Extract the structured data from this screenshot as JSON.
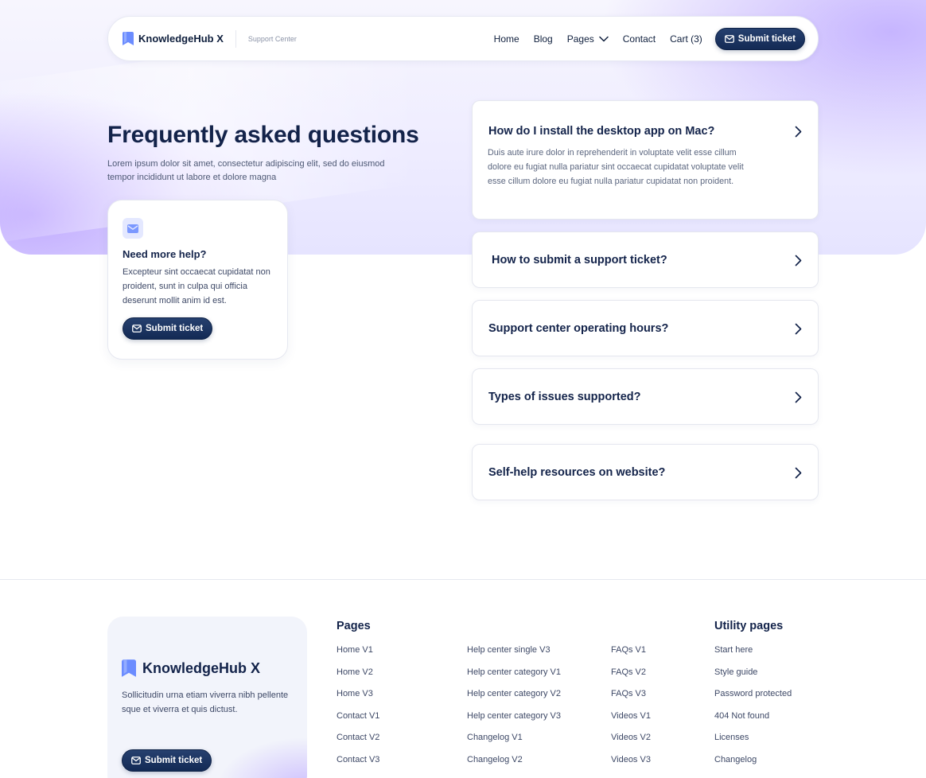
{
  "brand": {
    "name": "KnowledgeHub X",
    "subtitle": "Support Center"
  },
  "nav": {
    "links": [
      "Home",
      "Blog",
      "Pages",
      "Contact",
      "Cart (3)"
    ],
    "cta": "Submit ticket"
  },
  "hero": {
    "title": "Frequently asked questions",
    "description": "Lorem ipsum dolor sit amet, consectetur adipiscing elit, sed do eiusmod tempor incididunt ut labore et dolore magna"
  },
  "help_card": {
    "title": "Need more help?",
    "text": "Excepteur sint occaecat cupidatat non proident, sunt in culpa qui officia deserunt mollit anim id est.",
    "button": "Submit ticket"
  },
  "faqs": [
    {
      "question": "How do I install the desktop app on Mac?",
      "answer": "Duis aute irure dolor in reprehenderit in voluptate velit esse cillum dolore eu fugiat nulla pariatur sint occaecat cupidatat voluptate velit esse cillum dolore eu fugiat nulla pariatur cupidatat non proident.",
      "expanded": true
    },
    {
      "question": "How to submit a support ticket?",
      "expanded": false
    },
    {
      "question": "Support center operating hours?",
      "expanded": false
    },
    {
      "question": "Types of issues supported?",
      "expanded": false
    },
    {
      "question": "Self-help resources on website?",
      "expanded": false
    }
  ],
  "footer": {
    "brand_name": "KnowledgeHub X",
    "text": "Sollicitudin urna etiam viverra nibh pellente sque et viverra et quis dictust.",
    "button": "Submit ticket",
    "pages_title": "Pages",
    "pages_col1": [
      "Home V1",
      "Home V2",
      "Home V3",
      "Contact V1",
      "Contact V2",
      "Contact V3"
    ],
    "pages_col2": [
      "Help center single V3",
      "Help center category V1",
      "Help center category V2",
      "Help center category V3",
      "Changelog V1",
      "Changelog V2"
    ],
    "pages_col3": [
      "FAQs V1",
      "FAQs V2",
      "FAQs V3",
      "Videos V1",
      "Videos V2",
      "Videos V3"
    ],
    "utility_title": "Utility pages",
    "utility_links": [
      "Start here",
      "Style guide",
      "Password protected",
      "404 Not found",
      "Licenses",
      "Changelog"
    ]
  },
  "colors": {
    "accent": "#132a55",
    "logo": "#6b8cff",
    "heading": "#13234a",
    "text": "#3d4866"
  },
  "icons": {
    "brand": "bookmark-logo-icon",
    "mail": "mail-icon",
    "chevron": "chevron-right-icon",
    "dropdown": "chevron-down-icon"
  }
}
